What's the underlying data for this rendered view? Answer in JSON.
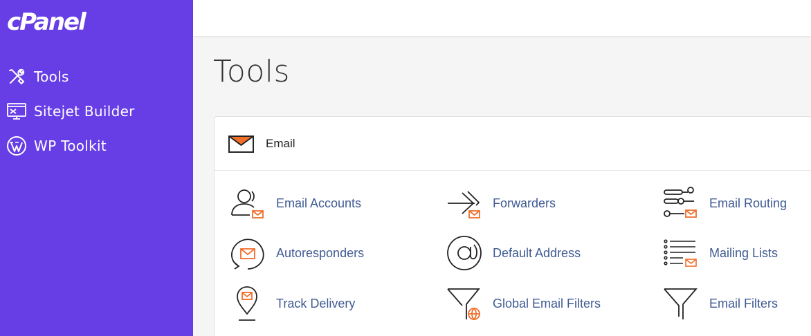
{
  "brand": {
    "logo_text": "cPanel",
    "accent_color": "#673de6",
    "icon_orange": "#f06d2a",
    "link_color": "#3f5a93"
  },
  "sidebar": {
    "items": [
      {
        "label": "Tools",
        "icon": "tools-icon"
      },
      {
        "label": "Sitejet Builder",
        "icon": "sitejet-icon"
      },
      {
        "label": "WP Toolkit",
        "icon": "wordpress-icon"
      }
    ]
  },
  "main": {
    "page_title": "Tools",
    "sections": [
      {
        "title": "Email",
        "icon": "envelope-icon",
        "tools": [
          {
            "label": "Email Accounts",
            "icon": "email-accounts-icon"
          },
          {
            "label": "Forwarders",
            "icon": "forwarders-icon"
          },
          {
            "label": "Email Routing",
            "icon": "email-routing-icon"
          },
          {
            "label": "Autoresponders",
            "icon": "autoresponders-icon"
          },
          {
            "label": "Default Address",
            "icon": "default-address-icon"
          },
          {
            "label": "Mailing Lists",
            "icon": "mailing-lists-icon"
          },
          {
            "label": "Track Delivery",
            "icon": "track-delivery-icon"
          },
          {
            "label": "Global Email Filters",
            "icon": "global-email-filters-icon"
          },
          {
            "label": "Email Filters",
            "icon": "email-filters-icon"
          }
        ]
      }
    ]
  }
}
